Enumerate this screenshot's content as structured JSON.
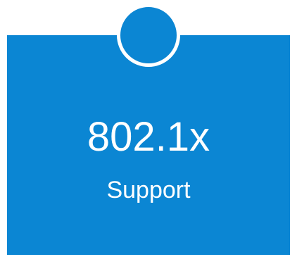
{
  "feature": {
    "title": "802.1x",
    "subtitle": "Support"
  },
  "colors": {
    "card_background": "#0b86d3",
    "text": "#ffffff",
    "page_background": "#ffffff"
  },
  "icons": {
    "badge": "circle-badge-icon"
  }
}
